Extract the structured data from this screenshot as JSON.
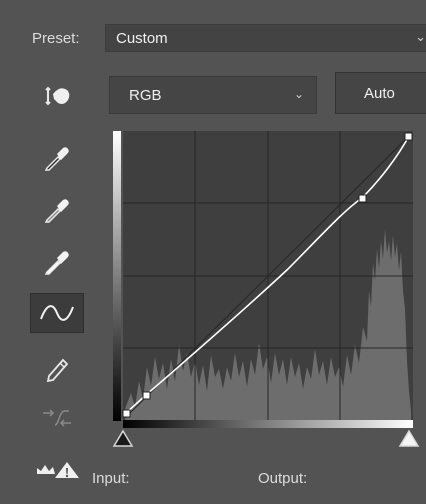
{
  "preset": {
    "label": "Preset:",
    "value": "Custom"
  },
  "channel": {
    "value": "RGB"
  },
  "auto_label": "Auto",
  "tools": [
    "on-image-adjust-icon",
    "sample-black-point-icon",
    "sample-gray-point-icon",
    "sample-white-point-icon",
    "edit-curve-points-icon",
    "draw-curve-pencil-icon",
    "smooth-curve-icon"
  ],
  "io": {
    "input_label": "Input:",
    "output_label": "Output:"
  },
  "colors": {
    "panel": "#535353",
    "graph_bg": "#3f3f3f",
    "curve": "#ffffff"
  }
}
